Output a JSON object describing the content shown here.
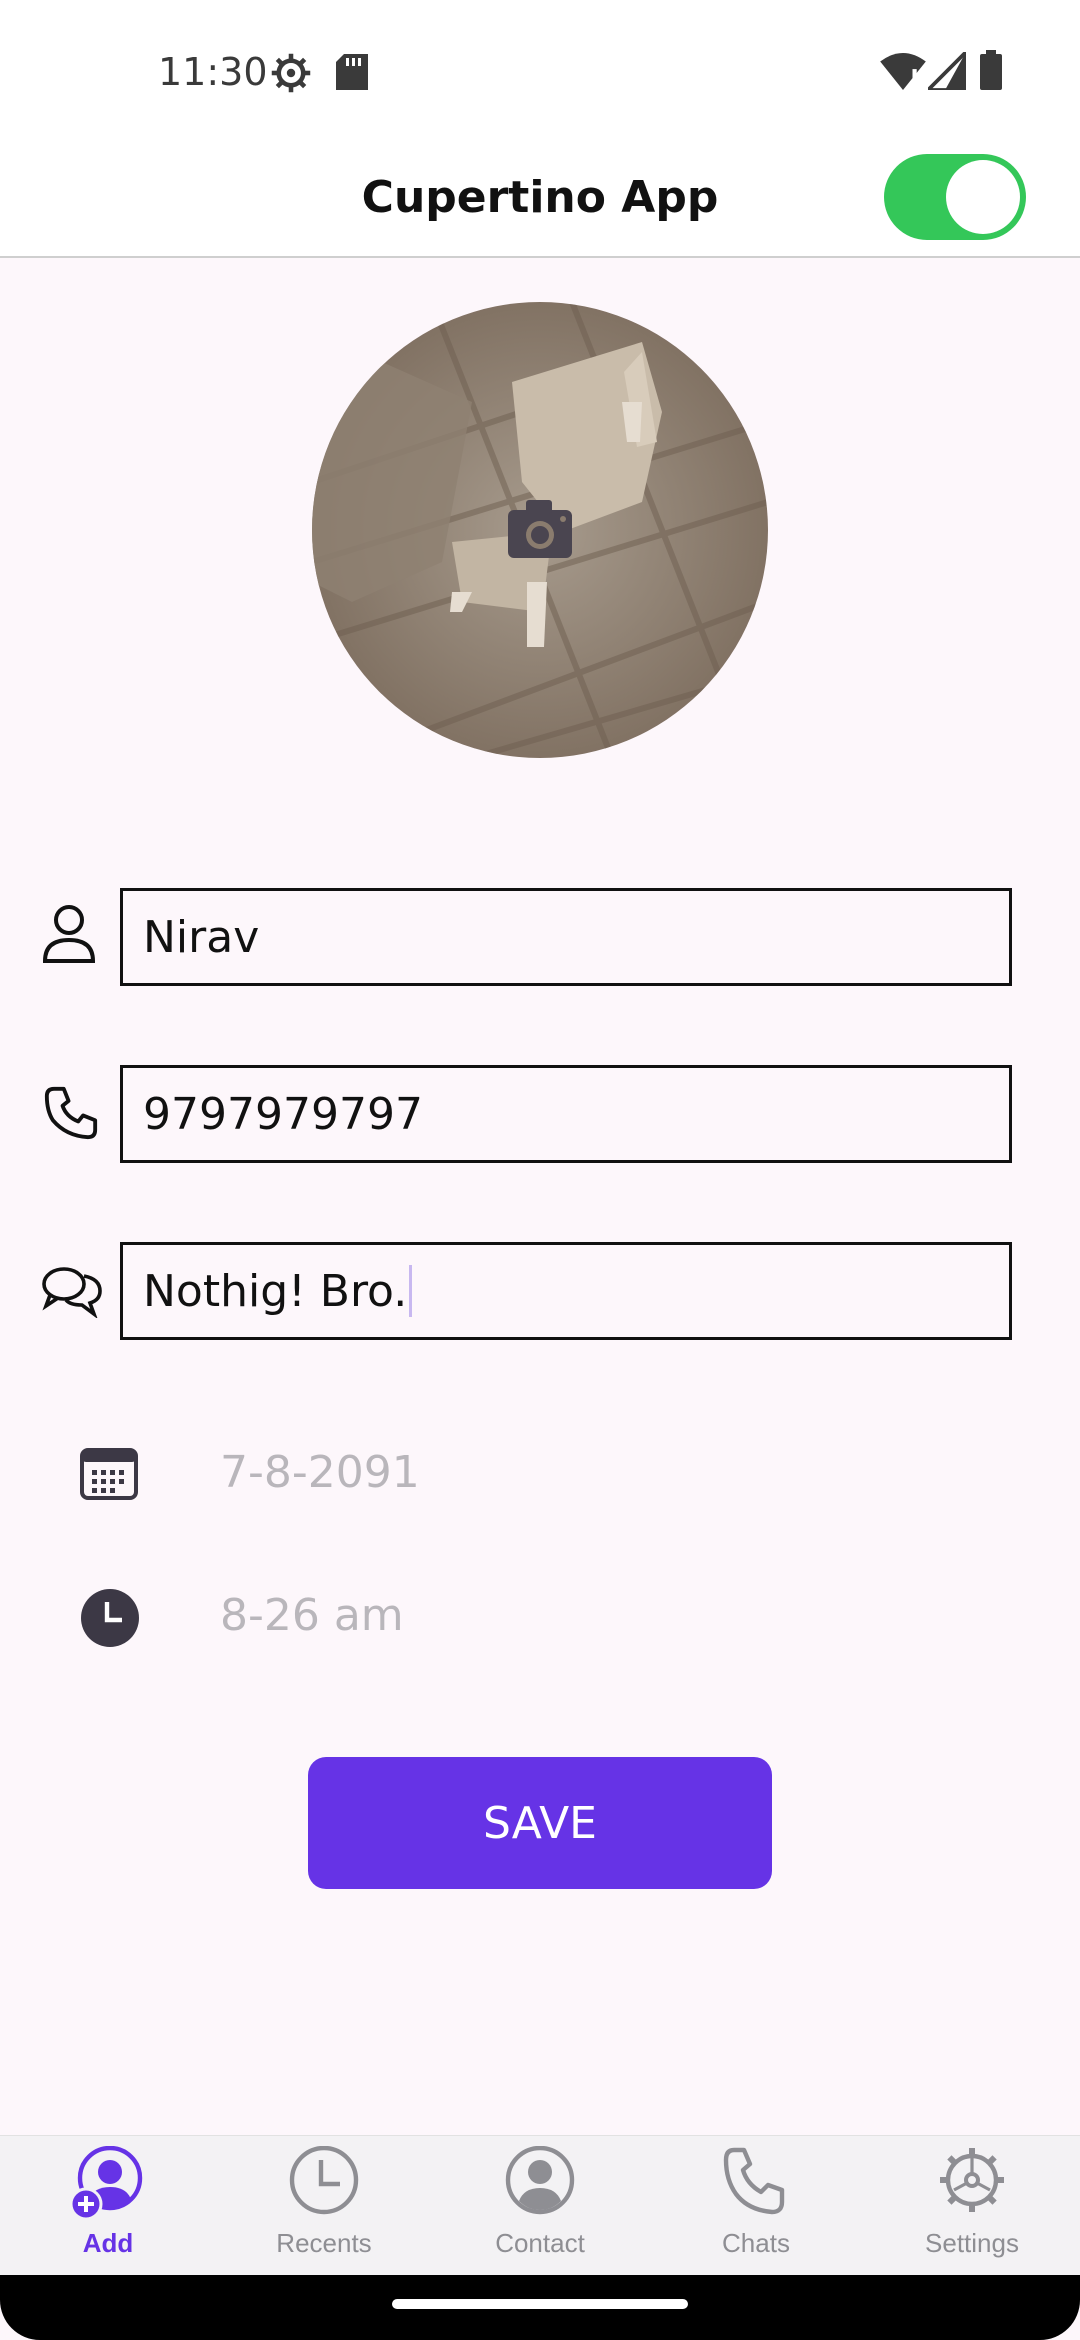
{
  "status_bar": {
    "time": "11:30",
    "icons": [
      "settings-icon",
      "sd-card-icon",
      "wifi-icon",
      "signal-icon",
      "battery-icon"
    ]
  },
  "header": {
    "title": "Cupertino App",
    "toggle_on": true,
    "toggle_color": "#34c759"
  },
  "avatar": {
    "icon": "camera-icon"
  },
  "form": {
    "name": {
      "icon": "person-icon",
      "value": "Nirav"
    },
    "phone": {
      "icon": "phone-icon",
      "value": "9797979797"
    },
    "message": {
      "icon": "chat-bubbles-icon",
      "value": "Nothig! Bro."
    },
    "date": {
      "icon": "calendar-icon",
      "value": "7-8-2091"
    },
    "time": {
      "icon": "clock-icon",
      "value": "8-26 am"
    }
  },
  "save_button": {
    "label": "SAVE",
    "color": "#6633e6"
  },
  "tab_bar": {
    "active_color": "#6633e6",
    "inactive_color": "#8e8e93",
    "tabs": [
      {
        "label": "Add",
        "icon": "add-person-icon",
        "active": true
      },
      {
        "label": "Recents",
        "icon": "clock-icon",
        "active": false
      },
      {
        "label": "Contact",
        "icon": "person-circle-icon",
        "active": false
      },
      {
        "label": "Chats",
        "icon": "phone-icon",
        "active": false
      },
      {
        "label": "Settings",
        "icon": "gear-icon",
        "active": false
      }
    ]
  }
}
